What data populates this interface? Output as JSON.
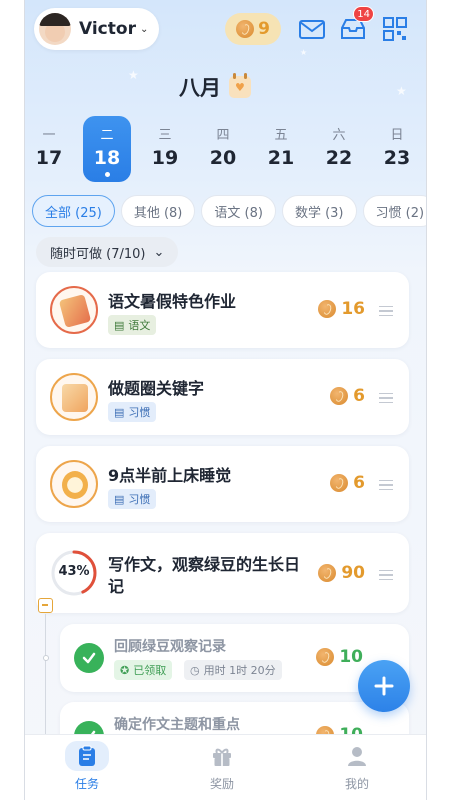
{
  "header": {
    "user_name": "Victor",
    "coin_count": "9",
    "inbox_badge": "14"
  },
  "calendar": {
    "month": "八月",
    "days": [
      {
        "weekday": "一",
        "date": "17",
        "selected": false
      },
      {
        "weekday": "二",
        "date": "18",
        "selected": true
      },
      {
        "weekday": "三",
        "date": "19",
        "selected": false
      },
      {
        "weekday": "四",
        "date": "20",
        "selected": false
      },
      {
        "weekday": "五",
        "date": "21",
        "selected": false
      },
      {
        "weekday": "六",
        "date": "22",
        "selected": false
      },
      {
        "weekday": "日",
        "date": "23",
        "selected": false
      }
    ]
  },
  "tabs": [
    {
      "label": "全部 (25)",
      "active": true
    },
    {
      "label": "其他 (8)",
      "active": false
    },
    {
      "label": "语文 (8)",
      "active": false
    },
    {
      "label": "数学 (3)",
      "active": false
    },
    {
      "label": "习惯 (2)",
      "active": false
    }
  ],
  "filter": {
    "label": "随时可做 (7/10)"
  },
  "tasks": [
    {
      "title": "语文暑假特色作业",
      "tag": "语文",
      "reward": "16"
    },
    {
      "title": "做题圈关键字",
      "tag": "习惯",
      "reward": "6"
    },
    {
      "title": "9点半前上床睡觉",
      "tag": "习惯",
      "reward": "6"
    }
  ],
  "parent_task": {
    "title_line1": "写作文，观察绿豆的生长日",
    "title_line2": "记",
    "progress": "43%",
    "progress_value": 0.43,
    "reward": "90"
  },
  "subtasks": [
    {
      "title": "回顾绿豆观察记录",
      "claimed": "已领取",
      "time": "用时 1时 20分",
      "reward": "10"
    },
    {
      "title": "确定作文主题和重点",
      "reward": "10"
    }
  ],
  "bottom_nav": [
    {
      "label": "任务",
      "active": true
    },
    {
      "label": "奖励",
      "active": false
    },
    {
      "label": "我的",
      "active": false
    }
  ],
  "colors": {
    "accent": "#2a7ee6",
    "coin": "#e39a2d",
    "done": "#38b25a"
  }
}
